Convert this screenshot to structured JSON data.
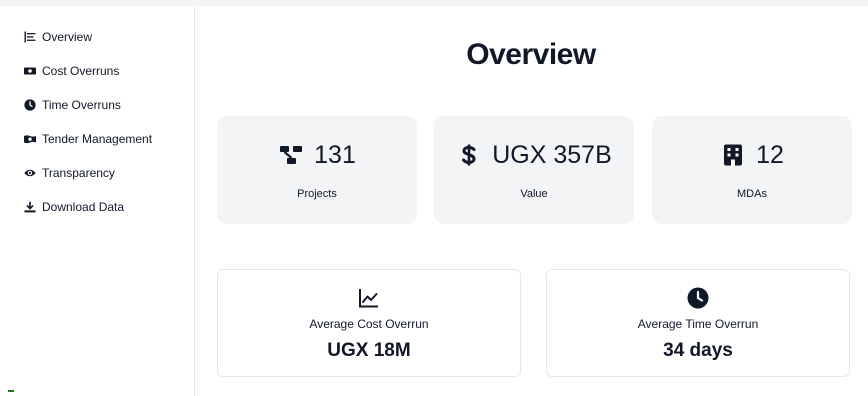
{
  "sidebar": {
    "items": [
      {
        "label": "Overview",
        "icon": "list-check-icon"
      },
      {
        "label": "Cost Overruns",
        "icon": "money-bill-icon"
      },
      {
        "label": "Time Overruns",
        "icon": "clock-icon"
      },
      {
        "label": "Tender Management",
        "icon": "money-bill-wave-icon"
      },
      {
        "label": "Transparency",
        "icon": "eye-icon"
      },
      {
        "label": "Download Data",
        "icon": "download-icon"
      }
    ]
  },
  "main": {
    "title": "Overview",
    "stats": [
      {
        "value": "131",
        "label": "Projects",
        "icon": "project-diagram-icon"
      },
      {
        "value": "UGX 357B",
        "label": "Value",
        "icon": "dollar-sign-icon"
      },
      {
        "value": "12",
        "label": "MDAs",
        "icon": "building-icon"
      }
    ],
    "averages": [
      {
        "label": "Average Cost Overrun",
        "value": "UGX 18M",
        "icon": "chart-line-icon"
      },
      {
        "label": "Average Time Overrun",
        "value": "34 days",
        "icon": "clock-icon"
      }
    ]
  },
  "colors": {
    "card_background": "#f3f4f6",
    "text": "#111827",
    "border": "#e5e7eb"
  }
}
